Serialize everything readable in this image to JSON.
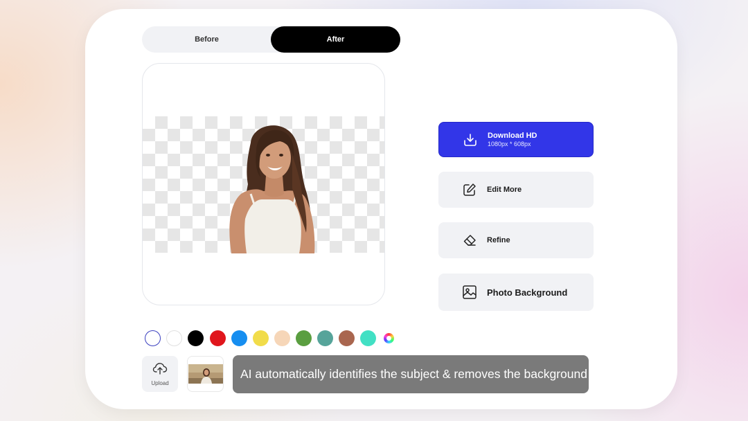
{
  "toggle": {
    "before_label": "Before",
    "after_label": "After",
    "selected": "After"
  },
  "actions": {
    "download": {
      "label": "Download HD",
      "sub": "1080px * 608px",
      "icon": "download-icon",
      "color": "#3236e8"
    },
    "edit": {
      "label": "Edit More",
      "icon": "edit-icon"
    },
    "refine": {
      "label": "Refine",
      "icon": "eraser-icon"
    },
    "photo_bg": {
      "label": "Photo Background",
      "icon": "image-icon"
    }
  },
  "swatches": [
    {
      "name": "transparent",
      "color": "#ffffff",
      "selected": true
    },
    {
      "name": "white",
      "color": "#ffffff"
    },
    {
      "name": "black",
      "color": "#000000"
    },
    {
      "name": "red",
      "color": "#e0161c"
    },
    {
      "name": "blue",
      "color": "#168ef0"
    },
    {
      "name": "yellow",
      "color": "#f1dc4a"
    },
    {
      "name": "peach",
      "color": "#f6d6b8"
    },
    {
      "name": "green",
      "color": "#5a9e40"
    },
    {
      "name": "teal",
      "color": "#56a49a"
    },
    {
      "name": "brown",
      "color": "#a9664f"
    },
    {
      "name": "aqua",
      "color": "#42e0c4"
    },
    {
      "name": "custom-color",
      "color": "conic"
    }
  ],
  "upload": {
    "label": "Upload",
    "icon": "cloud-upload-icon"
  },
  "caption": "AI automatically identifies the subject & removes the background"
}
